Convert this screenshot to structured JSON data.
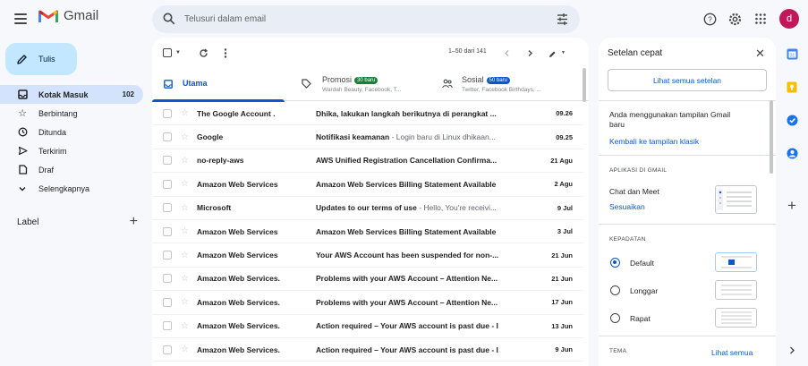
{
  "app": {
    "name": "Gmail"
  },
  "colors": {
    "accent": "#0b57d0",
    "compose_bg": "#c2e7ff",
    "active_nav": "#d3e3fd",
    "badge_green": "#188038",
    "badge_blue": "#0b57d0",
    "avatar": "#c2185b"
  },
  "header": {
    "search_placeholder": "Telusuri dalam email",
    "avatar_letter": "d",
    "icons": [
      "menu-icon",
      "search-icon",
      "filter-icon",
      "help-icon",
      "gear-icon",
      "apps-icon"
    ]
  },
  "compose": {
    "label": "Tulis"
  },
  "nav": {
    "items": [
      {
        "label": "Kotak Masuk",
        "count": "102",
        "icon": "inbox-icon",
        "active": true
      },
      {
        "label": "Berbintang",
        "count": "",
        "icon": "star-icon"
      },
      {
        "label": "Ditunda",
        "count": "",
        "icon": "clock-icon"
      },
      {
        "label": "Terkirim",
        "count": "",
        "icon": "send-icon"
      },
      {
        "label": "Draf",
        "count": "",
        "icon": "draft-icon"
      },
      {
        "label": "Selengkapnya",
        "count": "",
        "icon": "chevron-down-icon"
      }
    ],
    "labels_title": "Label"
  },
  "toolbar": {
    "pagination": "1–50 dari 141"
  },
  "tabs": [
    {
      "label": "Utama",
      "sub": "",
      "badge": ""
    },
    {
      "label": "Promosi",
      "sub": "Wardah Beauty, Facebook, T...",
      "badge": "30 baru"
    },
    {
      "label": "Sosial",
      "sub": "Twitter, Facebook Birthdays, ...",
      "badge": "50 baru"
    }
  ],
  "emails": [
    {
      "sender": "The Google Account .",
      "subject": "Dhika, lakukan langkah berikutnya di perangkat ...",
      "snippet": "",
      "date": "09.26"
    },
    {
      "sender": "Google",
      "subject": "Notifikasi keamanan",
      "snippet": " - Login baru di Linux dhikaan...",
      "date": "09.25"
    },
    {
      "sender": "no-reply-aws",
      "subject": "AWS Unified Registration Cancellation Confirma...",
      "snippet": "",
      "date": "21 Agu"
    },
    {
      "sender": "Amazon Web Services",
      "subject": "Amazon Web Services Billing Statement Available",
      "snippet": "",
      "date": "2 Agu"
    },
    {
      "sender": "Microsoft",
      "subject": "Updates to our terms of use",
      "snippet": " - Hello, You're receivi...",
      "date": "9 Jul"
    },
    {
      "sender": "Amazon Web Services",
      "subject": "Amazon Web Services Billing Statement Available",
      "snippet": "",
      "date": "3 Jul"
    },
    {
      "sender": "Amazon Web Services",
      "subject": "Your AWS Account has been suspended for non-...",
      "snippet": "",
      "date": "21 Jun"
    },
    {
      "sender": "Amazon Web Services.",
      "subject": "Problems with your AWS Account – Attention Ne...",
      "snippet": "",
      "date": "21 Jun"
    },
    {
      "sender": "Amazon Web Services.",
      "subject": "Problems with your AWS Account – Attention Ne...",
      "snippet": "",
      "date": "17 Jun"
    },
    {
      "sender": "Amazon Web Services.",
      "subject": "Action required – Your AWS account is past due - I",
      "snippet": "",
      "date": "13 Jun"
    },
    {
      "sender": "Amazon Web Services.",
      "subject": "Action required – Your AWS account is past due - I",
      "snippet": "",
      "date": "9 Jun"
    }
  ],
  "quick_settings": {
    "title": "Setelan cepat",
    "see_all": "Lihat semua setelan",
    "view_notice": "Anda menggunakan tampilan Gmail baru",
    "classic_link": "Kembali ke tampilan klasik",
    "apps_heading": "APLIKASI DI GMAIL",
    "chat_meet": "Chat dan Meet",
    "customize": "Sesuaikan",
    "density_heading": "KEPADATAN",
    "density_options": [
      {
        "label": "Default",
        "selected": true
      },
      {
        "label": "Longgar",
        "selected": false
      },
      {
        "label": "Rapat",
        "selected": false
      }
    ],
    "theme_heading": "TEMA",
    "see_all_themes": "Lihat semua"
  },
  "right_rail": {
    "icons": [
      "calendar-icon",
      "keep-icon",
      "tasks-icon",
      "contacts-icon",
      "plus-icon",
      "expand-icon"
    ]
  }
}
